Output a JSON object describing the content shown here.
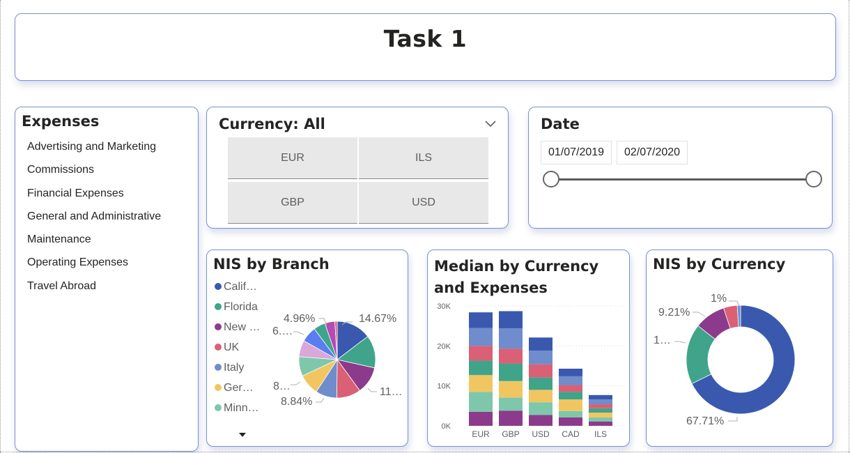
{
  "title": "Task 1",
  "expenses": {
    "heading": "Expenses",
    "items": [
      "Advertising and Marketing",
      "Commissions",
      "Financial Expenses",
      "General and Administrative",
      "Maintenance",
      "Operating Expenses",
      "Travel Abroad"
    ]
  },
  "currency_filter": {
    "heading": "Currency: All",
    "options": [
      "EUR",
      "ILS",
      "GBP",
      "USD"
    ]
  },
  "date_filter": {
    "heading": "Date",
    "start": "01/07/2019",
    "end": "02/07/2020"
  },
  "colors": {
    "blue": "#3a59ae",
    "teal": "#3fa48a",
    "purple": "#8c3b8c",
    "pink": "#d96075",
    "steel": "#6f8ccc",
    "yellow": "#f1c660",
    "mint": "#7ec7ab",
    "lilac": "#d9a8d8",
    "bright_blue": "#5a7ef0",
    "magenta": "#b44ab8"
  },
  "chart_data": [
    {
      "type": "pie",
      "title": "NIS by Branch",
      "legend": [
        {
          "label": "Calif…",
          "color": "#3a59ae"
        },
        {
          "label": "Florida",
          "color": "#3fa48a"
        },
        {
          "label": "New …",
          "color": "#8c3b8c"
        },
        {
          "label": "UK",
          "color": "#d96075"
        },
        {
          "label": "Italy",
          "color": "#6f8ccc"
        },
        {
          "label": "Ger…",
          "color": "#f1c660"
        },
        {
          "label": "Minn…",
          "color": "#7ec7ab"
        }
      ],
      "slices": [
        {
          "value": 14.67,
          "color": "#3a59ae",
          "label": "14.67%"
        },
        {
          "value": 13.8,
          "color": "#3fa48a",
          "label": ""
        },
        {
          "value": 11.5,
          "color": "#8c3b8c",
          "label": "11…"
        },
        {
          "value": 10.2,
          "color": "#d96075",
          "label": ""
        },
        {
          "value": 9.0,
          "color": "#6f8ccc",
          "label": ""
        },
        {
          "value": 8.84,
          "color": "#f1c660",
          "label": "8.84%"
        },
        {
          "value": 8.2,
          "color": "#7ec7ab",
          "label": "8…"
        },
        {
          "value": 7.0,
          "color": "#d9a8d8",
          "label": ""
        },
        {
          "value": 6.6,
          "color": "#5a7ef0",
          "label": "6.…"
        },
        {
          "value": 4.96,
          "color": "#3fa48a",
          "label": "4.96%"
        },
        {
          "value": 4.2,
          "color": "#b44ab8",
          "label": ""
        },
        {
          "value": 1.0,
          "color": "#d96075",
          "label": ""
        }
      ]
    },
    {
      "type": "bar",
      "stacked": true,
      "title": "Median by Currency and Expenses",
      "categories": [
        "EUR",
        "GBP",
        "USD",
        "CAD",
        "ILS"
      ],
      "ylim": [
        0,
        30000
      ],
      "yticks": [
        {
          "value": 0,
          "label": "0K"
        },
        {
          "value": 10000,
          "label": "10K"
        },
        {
          "value": 20000,
          "label": "20K"
        },
        {
          "value": 30000,
          "label": "30K"
        }
      ],
      "grid": true,
      "series": [
        {
          "color": "#8c3b8c",
          "values": [
            3500,
            3800,
            2700,
            2100,
            1100
          ]
        },
        {
          "color": "#7ec7ab",
          "values": [
            5000,
            3300,
            3200,
            1600,
            1000
          ]
        },
        {
          "color": "#f1c660",
          "values": [
            4200,
            4100,
            3100,
            2900,
            1200
          ]
        },
        {
          "color": "#3fa48a",
          "values": [
            3600,
            4400,
            3100,
            1900,
            1100
          ]
        },
        {
          "color": "#d96075",
          "values": [
            3700,
            3700,
            3300,
            1700,
            1000
          ]
        },
        {
          "color": "#6f8ccc",
          "values": [
            4500,
            5100,
            3400,
            2200,
            1200
          ]
        },
        {
          "color": "#3a59ae",
          "values": [
            3900,
            4300,
            3300,
            1900,
            1100
          ]
        }
      ]
    },
    {
      "type": "pie",
      "donut": true,
      "title": "NIS by Currency",
      "slices": [
        {
          "value": 67.71,
          "color": "#3a59ae",
          "label": "67.71%"
        },
        {
          "value": 18.0,
          "color": "#3fa48a",
          "label": "1…"
        },
        {
          "value": 9.21,
          "color": "#8c3b8c",
          "label": "9.21%"
        },
        {
          "value": 4.08,
          "color": "#d96075",
          "label": ""
        },
        {
          "value": 1.0,
          "color": "#6f8ccc",
          "label": "1%"
        }
      ]
    }
  ]
}
